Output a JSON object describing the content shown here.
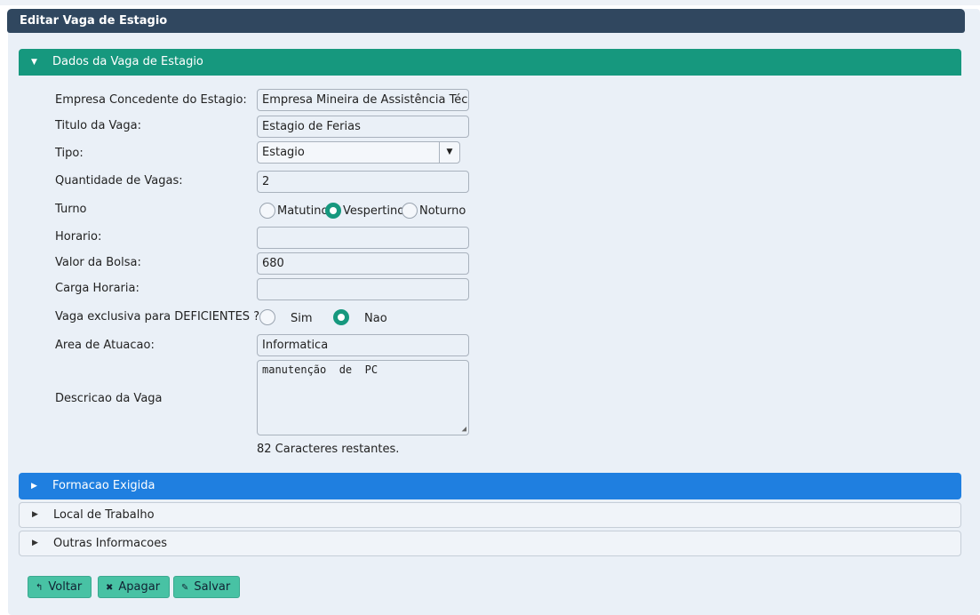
{
  "header": {
    "title": "Editar Vaga de Estagio"
  },
  "sections": {
    "dados": "Dados da Vaga de Estagio",
    "formacao": "Formacao Exigida",
    "local": "Local de Trabalho",
    "outras": "Outras Informacoes"
  },
  "form": {
    "empresa_label": "Empresa Concedente do Estagio:",
    "empresa_value": "Empresa Mineira de Assistência Técnic",
    "titulo_label": "Titulo da Vaga:",
    "titulo_value": "Estagio de Ferias",
    "tipo_label": "Tipo:",
    "tipo_value": "Estagio",
    "quantidade_label": "Quantidade de Vagas:",
    "quantidade_value": "2",
    "turno_label": "Turno",
    "turno_options": [
      "Matutino",
      "Vespertino",
      "Noturno"
    ],
    "turno_selected": "Vespertino",
    "horario_label": "Horario:",
    "horario_value": "",
    "valor_label": "Valor da Bolsa:",
    "valor_value": "680",
    "carga_label": "Carga Horaria:",
    "carga_value": "",
    "deficientes_label": "Vaga exclusiva para DEFICIENTES ?",
    "deficientes_options": [
      "Sim",
      "Nao"
    ],
    "deficientes_selected": "Nao",
    "area_label": "Area de Atuacao:",
    "area_value": "Informatica",
    "descricao_label": "Descricao da Vaga",
    "descricao_value": "manutenção  de  PC",
    "chars_remaining": "82 Caracteres restantes."
  },
  "buttons": {
    "voltar": "Voltar",
    "apagar": "Apagar",
    "salvar": "Salvar"
  },
  "colors": {
    "header": "#30475f",
    "accent_green": "#16987e",
    "accent_blue": "#1f7fe0",
    "button": "#48c2a4"
  },
  "icons": {
    "expanded": "caret-down-icon",
    "collapsed": "caret-right-icon",
    "voltar": "undo-icon",
    "apagar": "x-icon",
    "salvar": "pencil-icon"
  }
}
